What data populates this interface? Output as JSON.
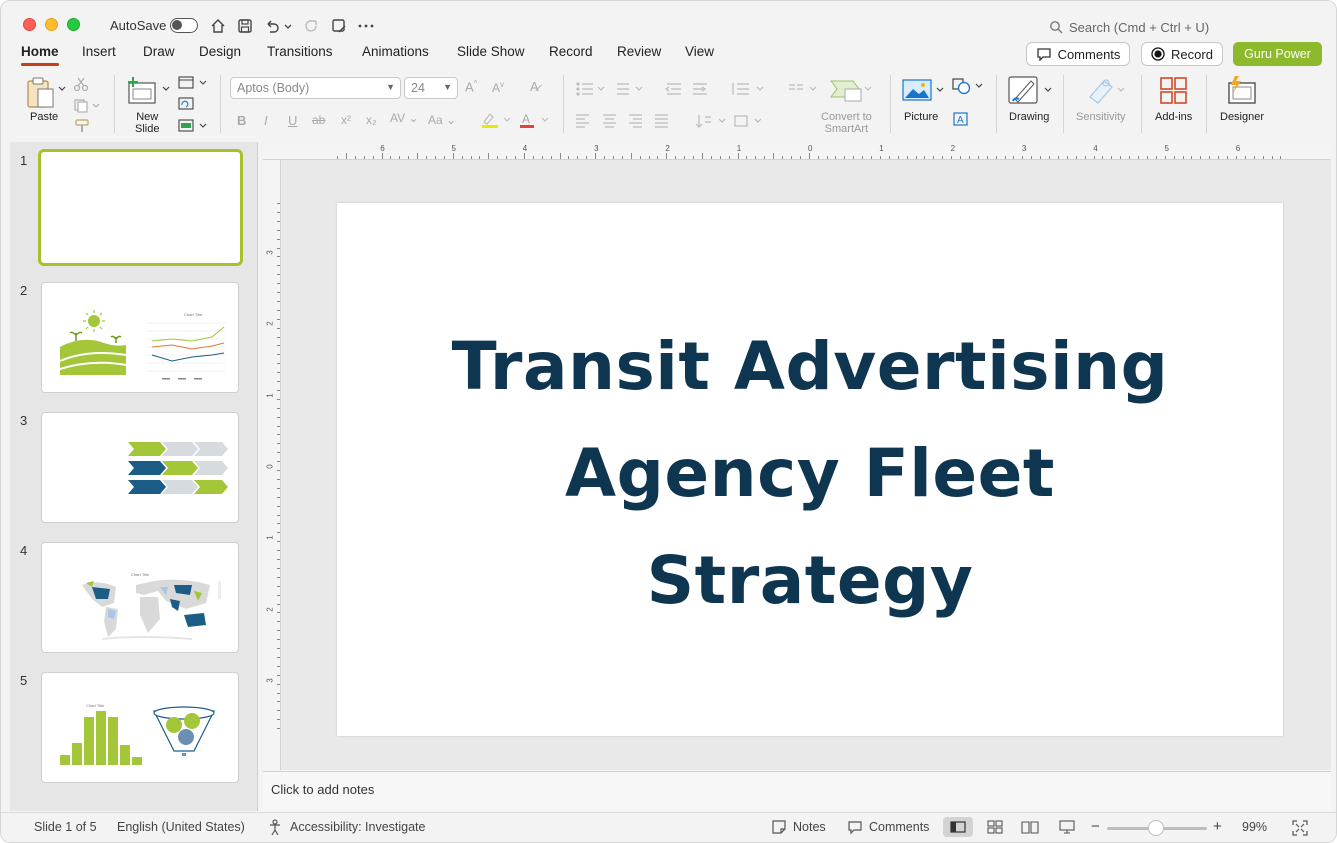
{
  "titlebar": {
    "autosave_label": "AutoSave",
    "search_placeholder": "Search (Cmd + Ctrl + U)"
  },
  "tabs": [
    "Home",
    "Insert",
    "Draw",
    "Design",
    "Transitions",
    "Animations",
    "Slide Show",
    "Record",
    "Review",
    "View"
  ],
  "header_buttons": {
    "comments": "Comments",
    "record": "Record",
    "guru": "Guru Power"
  },
  "ribbon": {
    "paste": "Paste",
    "new_slide": "New\nSlide",
    "font_name": "Aptos (Body)",
    "font_size": "24",
    "convert_smartart": "Convert to\nSmartArt",
    "picture": "Picture",
    "drawing": "Drawing",
    "sensitivity": "Sensitivity",
    "addins": "Add-ins",
    "designer": "Designer"
  },
  "thumbnails": [
    {
      "num": "1"
    },
    {
      "num": "2"
    },
    {
      "num": "3"
    },
    {
      "num": "4"
    },
    {
      "num": "5"
    }
  ],
  "thumb_chart_titles": {
    "slide2": "Chart Title",
    "slide4": "Chart Title",
    "slide5": "Chart Title"
  },
  "slide": {
    "title": "Transit Advertising Agency Fleet Strategy"
  },
  "notes_placeholder": "Click to add notes",
  "statusbar": {
    "slide_count": "Slide 1 of 5",
    "language": "English (United States)",
    "accessibility": "Accessibility: Investigate",
    "notes": "Notes",
    "comments": "Comments",
    "zoom": "99%"
  },
  "ruler": {
    "h": [
      "6",
      "5",
      "4",
      "3",
      "2",
      "1",
      "0",
      "1",
      "2",
      "3",
      "4",
      "5",
      "6"
    ],
    "v": [
      "3",
      "2",
      "1",
      "0",
      "1",
      "2",
      "3"
    ]
  },
  "colors": {
    "accent_green": "#8dba2c",
    "title_navy": "#0e3650",
    "tab_underline": "#c43e1c"
  }
}
